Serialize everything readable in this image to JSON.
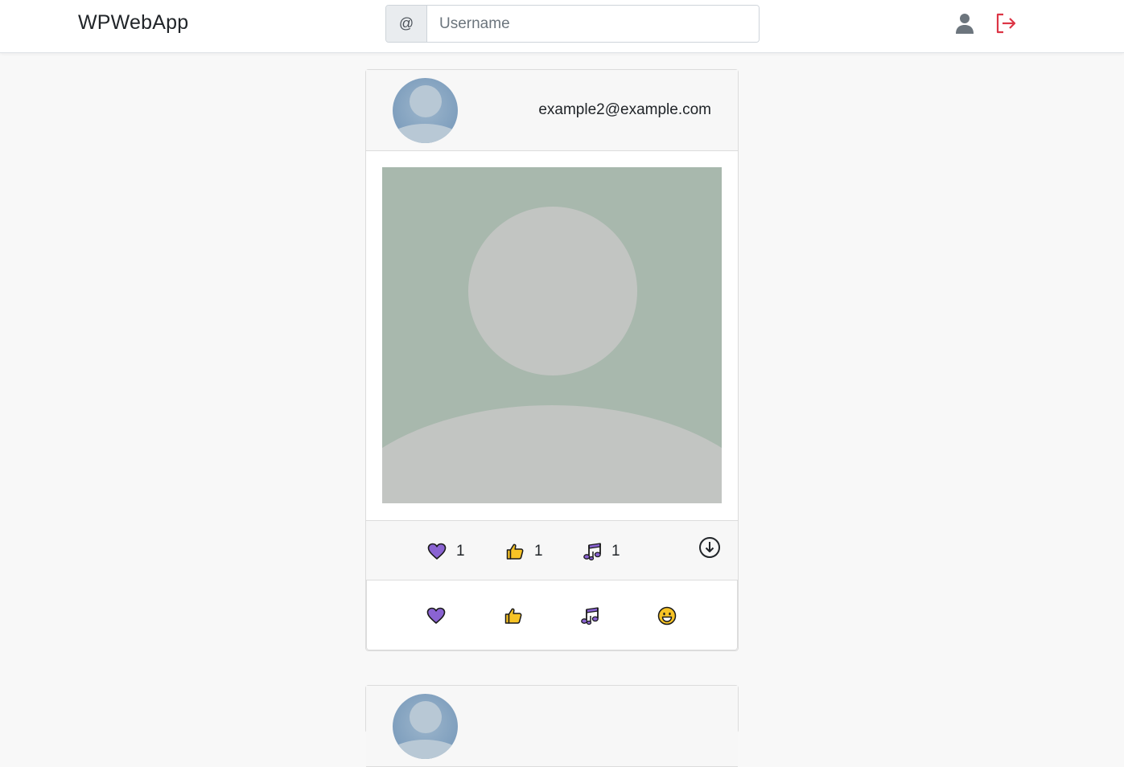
{
  "app": {
    "title": "WPWebApp"
  },
  "search": {
    "prefix": "@",
    "placeholder": "Username"
  },
  "nav": {
    "profile_icon": "user-icon",
    "logout_icon": "logout-icon",
    "logout_color": "#dc3545"
  },
  "posts": [
    {
      "author_email": "example2@example.com",
      "reactions": [
        {
          "icon": "purple-heart-icon",
          "count": "1"
        },
        {
          "icon": "thumbs-up-icon",
          "count": "1"
        },
        {
          "icon": "musical-notes-icon",
          "count": "1"
        }
      ],
      "actions": [
        "purple-heart-icon",
        "thumbs-up-icon",
        "musical-notes-icon",
        "grinning-face-icon"
      ],
      "download_icon": "download-circle-icon"
    }
  ],
  "colors": {
    "accent_purple": "#8a63d2",
    "emoji_yellow": "#f7c325",
    "image_bg": "#a8b8ad"
  }
}
